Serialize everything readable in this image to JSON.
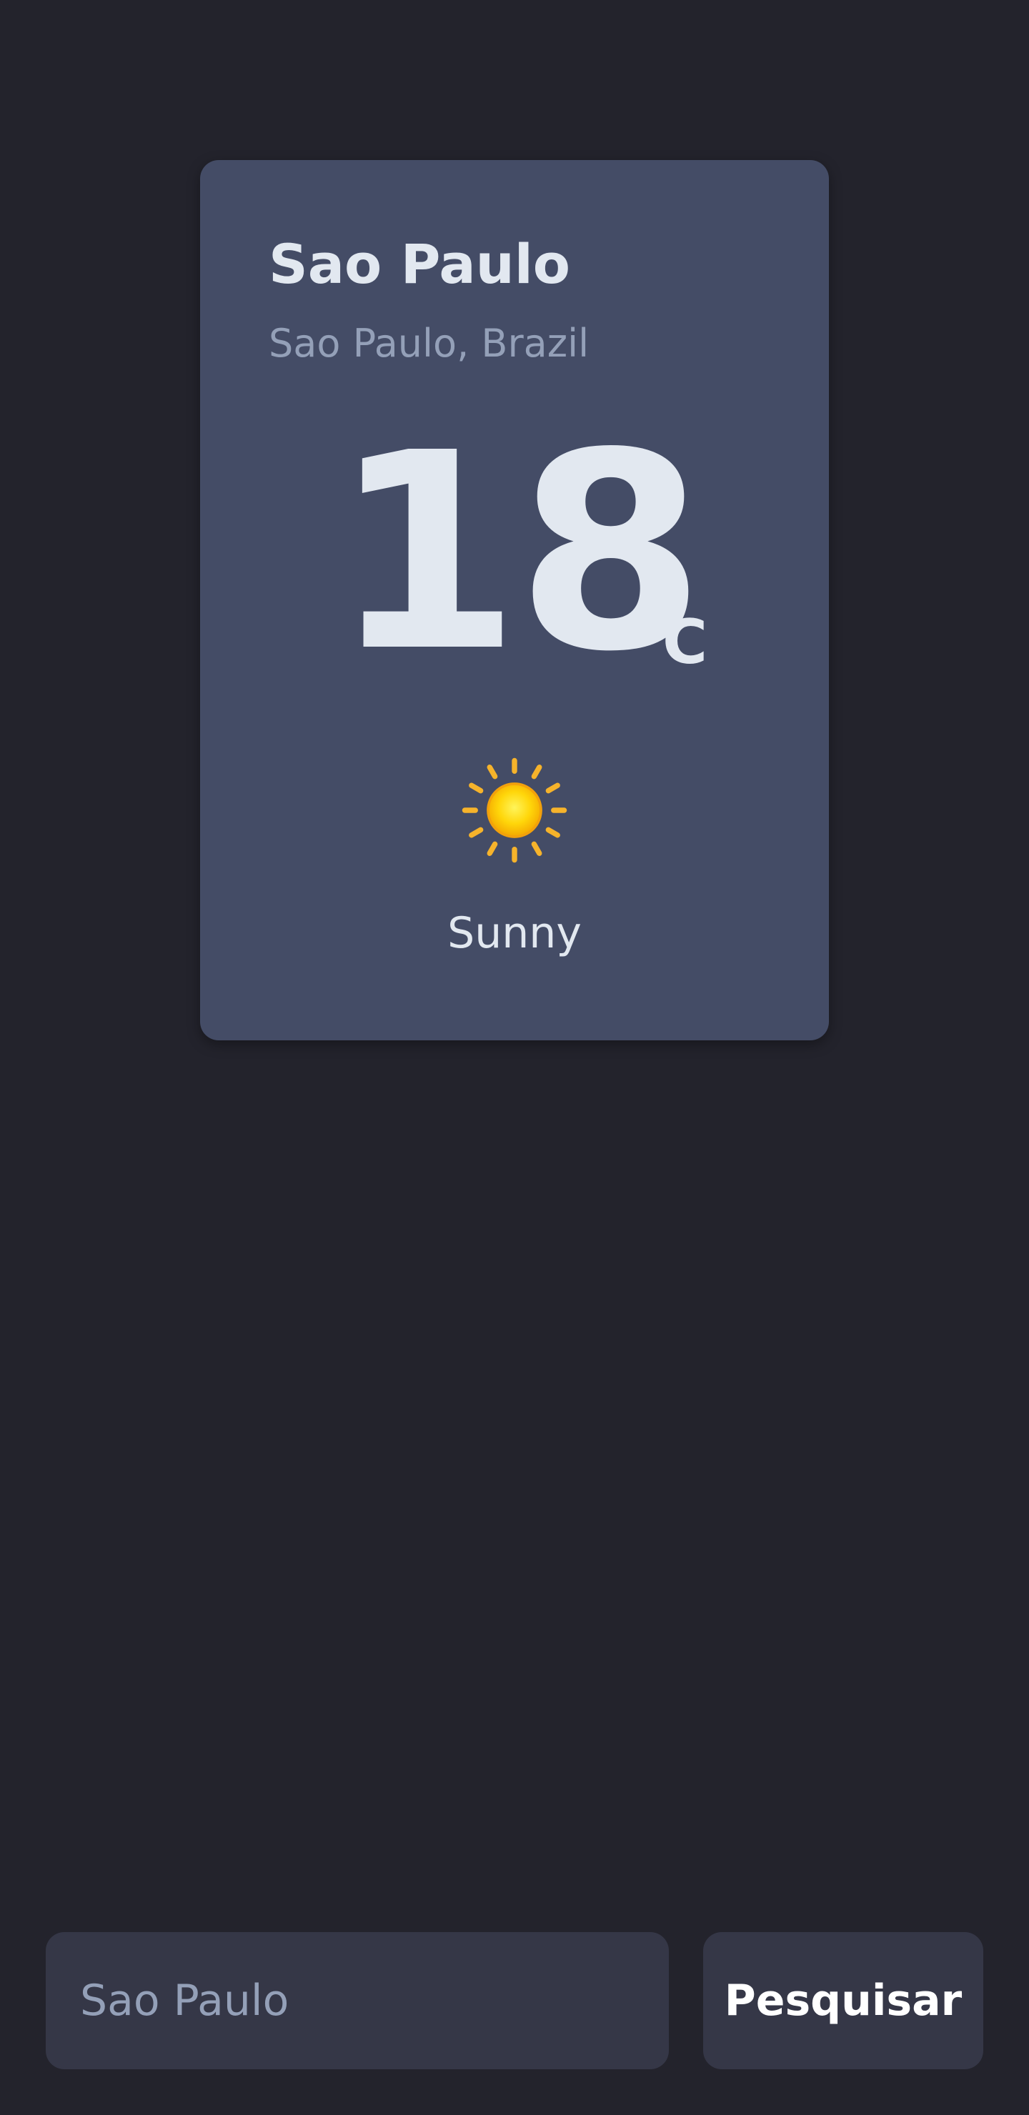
{
  "weather": {
    "city": "Sao Paulo",
    "region": "Sao Paulo, Brazil",
    "temperature": "18",
    "unit": "°C",
    "condition": "Sunny",
    "icon": "sun-icon"
  },
  "search": {
    "placeholder": "Sao Paulo",
    "value": "",
    "button_label": "Pesquisar"
  },
  "colors": {
    "background": "#23232c",
    "card": "#444c66",
    "text_primary": "#e2e8f0",
    "text_secondary": "#94a0b8",
    "input_bg": "#353747",
    "sun": "#fcd116"
  }
}
